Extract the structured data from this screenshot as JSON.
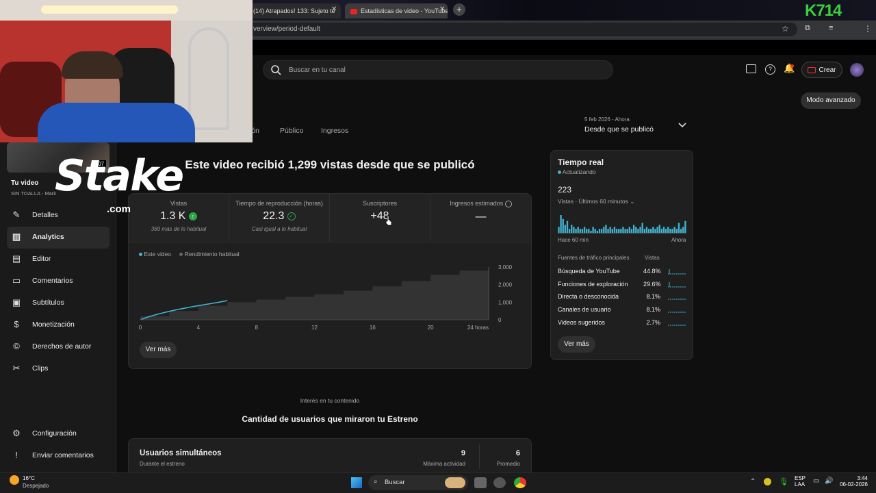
{
  "browser": {
    "tabs": [
      {
        "label": "(14) Atrapados! 133: Sujeto te"
      },
      {
        "label": "Estadísticas de video - YouTube"
      }
    ],
    "url": "verview/period-default",
    "corner_logo": "K714"
  },
  "header": {
    "search_placeholder": "Buscar en tu canal",
    "create_label": "Crear"
  },
  "advanced_mode": "Modo avanzado",
  "tabs": [
    {
      "label": "ión"
    },
    {
      "label": "Público"
    },
    {
      "label": "Ingresos"
    }
  ],
  "period": {
    "range": "5 feb 2026 - Ahora",
    "label": "Desde que se publicó"
  },
  "headline": "Este video recibió 1,299 vistas desde que se publicó",
  "sidebar": {
    "thumb_time": ":07",
    "video_title_label": "Tu video",
    "video_subtitle": "SIN TOALLA - Mark",
    "items": [
      {
        "label": "Detalles",
        "icon": "pencil-icon"
      },
      {
        "label": "Analytics",
        "icon": "bar-chart-icon"
      },
      {
        "label": "Editor",
        "icon": "film-editor-icon"
      },
      {
        "label": "Comentarios",
        "icon": "comment-icon"
      },
      {
        "label": "Subtítulos",
        "icon": "subtitles-icon"
      },
      {
        "label": "Monetización",
        "icon": "dollar-icon"
      },
      {
        "label": "Derechos de autor",
        "icon": "copyright-icon"
      },
      {
        "label": "Clips",
        "icon": "scissors-icon"
      }
    ],
    "bottom_items": [
      {
        "label": "Configuración",
        "icon": "gear-icon"
      },
      {
        "label": "Enviar comentarios",
        "icon": "feedback-icon"
      }
    ]
  },
  "metrics": [
    {
      "label": "Vistas",
      "value": "1.3 K",
      "sub": "369 más de lo habitual",
      "status": "up"
    },
    {
      "label": "Tiempo de reproducción (horas)",
      "value": "22.3",
      "sub": "Casi igual a lo habitual",
      "status": "check"
    },
    {
      "label": "Suscriptores",
      "value": "+48",
      "sub": "",
      "status": ""
    },
    {
      "label": "Ingresos estimados",
      "value": "—",
      "sub": "",
      "status": "clock"
    }
  ],
  "chart_data": {
    "type": "area",
    "series": [
      {
        "name": "Este video",
        "color": "#41b4d2",
        "x": [
          0,
          0.5,
          1,
          1.5,
          2,
          2.5,
          3,
          3.5,
          4,
          4.5,
          5,
          5.5,
          6
        ],
        "values": [
          0,
          150,
          270,
          380,
          480,
          570,
          650,
          730,
          800,
          870,
          940,
          1010,
          1090
        ]
      },
      {
        "name": "Rendimiento habitual",
        "color": "#3a3a3a",
        "x": [
          0,
          2,
          4,
          6,
          8,
          10,
          12,
          14,
          16,
          18,
          20,
          22,
          24
        ],
        "values": [
          200,
          500,
          800,
          1000,
          1150,
          1300,
          1450,
          1650,
          1900,
          2200,
          2550,
          2800,
          2950
        ]
      }
    ],
    "x_ticks": [
      "0",
      "4",
      "8",
      "12",
      "16",
      "20",
      "24 horas"
    ],
    "y_ticks": [
      "3,000",
      "2,000",
      "1,000",
      "0"
    ],
    "ylim": [
      0,
      3000
    ],
    "xlim": [
      0,
      24
    ],
    "legend": "top-left"
  },
  "ver_mas": "Ver más",
  "realtime": {
    "title": "Tiempo real",
    "status": "Actualizando",
    "count": "223",
    "desc": "Vistas · Últimos 60 minutos",
    "left_label": "Hace 60 min",
    "right_label": "Ahora",
    "bars": [
      3,
      9,
      7,
      4,
      6,
      2,
      4,
      3,
      2,
      3,
      2,
      2,
      3,
      2,
      2,
      1,
      3,
      2,
      1,
      2,
      2,
      3,
      4,
      2,
      3,
      2,
      3,
      2,
      2,
      2,
      3,
      2,
      2,
      3,
      2,
      4,
      3,
      2,
      3,
      5,
      2,
      3,
      2,
      2,
      3,
      2,
      3,
      4,
      2,
      3,
      2,
      3,
      2,
      2,
      3,
      2,
      5,
      2,
      3,
      6
    ],
    "sources_header": "Fuentes de tráfico principales",
    "views_header": "Vistas",
    "sources": [
      {
        "label": "Búsqueda de YouTube",
        "pct": "44.8%"
      },
      {
        "label": "Funciones de exploración",
        "pct": "29.6%"
      },
      {
        "label": "Directa o desconocida",
        "pct": "8.1%"
      },
      {
        "label": "Canales de usuario",
        "pct": "8.1%"
      },
      {
        "label": "Videos sugeridos",
        "pct": "2.7%"
      }
    ],
    "ver_mas": "Ver más"
  },
  "interest_label": "Interés en tu contenido",
  "premiere_title": "Cantidad de usuarios que miraron tu Estreno",
  "concurrent": {
    "title": "Usuarios simultáneos",
    "subtitle": "Durante el estreno",
    "peak_value": "9",
    "peak_label": "Máxima actividad",
    "avg_value": "6",
    "avg_label": "Promedio"
  },
  "overlay": {
    "stake_text": "Stake",
    "stake_com": ".com"
  },
  "taskbar": {
    "weather_temp": "16°C",
    "weather_desc": "Despejado",
    "search_label": "Buscar",
    "lang": "ESP",
    "lang2": "LAA",
    "time": "3:44",
    "date": "06-02-2026"
  }
}
